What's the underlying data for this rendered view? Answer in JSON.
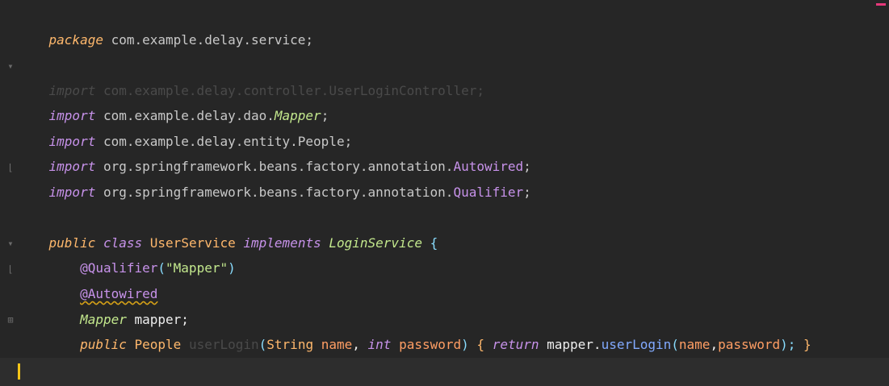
{
  "editor": {
    "lines": {
      "l1": {
        "kw": "package",
        "rest": " com.example.delay.service;"
      },
      "l3": {
        "kw": "import",
        "rest": " com.example.delay.controller.UserLoginController;"
      },
      "l4": {
        "kw": "import",
        "pkg": " com.example.delay.dao.",
        "name": "Mapper",
        "end": ";"
      },
      "l5": {
        "kw": "import",
        "pkg": " com.example.delay.entity.People;"
      },
      "l6": {
        "kw": "import",
        "pkg": " org.springframework.beans.factory.annotation.",
        "name": "Autowired",
        "end": ";"
      },
      "l7": {
        "kw": "import",
        "pkg": " org.springframework.beans.factory.annotation.",
        "name": "Qualifier",
        "end": ";"
      },
      "l9": {
        "kw1": "public",
        "kw2": "class",
        "cls": "UserService",
        "kw3": "implements",
        "iface": "LoginService",
        "brace": "{"
      },
      "l10": {
        "ann": "@Qualifier",
        "open": "(",
        "str": "\"Mapper\"",
        "close": ")"
      },
      "l11": {
        "ann": "@Autowired"
      },
      "l12": {
        "type": "Mapper",
        "ident": " mapper;"
      },
      "l13": {
        "kw1": "public",
        "type": "People",
        "method": "userLogin",
        "open": "(",
        "t1": "String",
        "p1": "name",
        "comma": ", ",
        "t2": "int",
        "p2": "password",
        "close": ")",
        "brace_open": "{",
        "ret": "return",
        "obj": "mapper.",
        "call": "userLogin",
        "args_open": "(",
        "a1": "name",
        "a_comma": ",",
        "a2": "password",
        "args_close": ");",
        "brace_close": "}"
      },
      "l14": {
        "brace": "}"
      }
    }
  }
}
